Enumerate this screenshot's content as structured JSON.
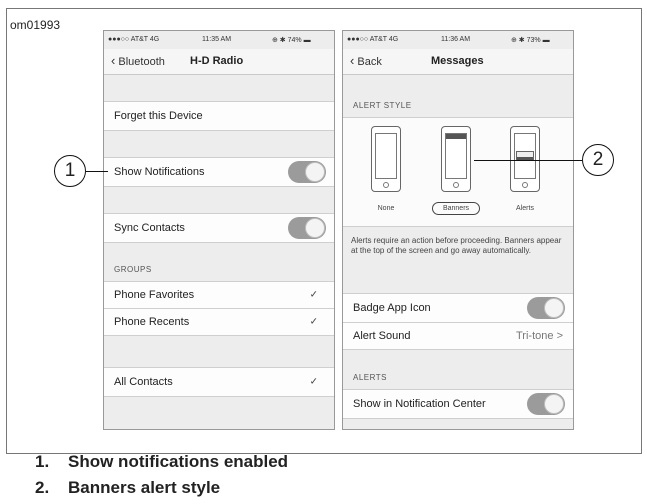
{
  "figure_id": "om01993",
  "phone1": {
    "status": {
      "carrier": "●●●○○ AT&T  4G",
      "time": "11:35 AM",
      "battery": "⊕ ✱ 74% ▬"
    },
    "nav": {
      "back": "Bluetooth",
      "title": "H-D Radio"
    },
    "forget": "Forget this Device",
    "show_notifications": {
      "label": "Show Notifications",
      "on": true
    },
    "sync_contacts": {
      "label": "Sync Contacts",
      "on": true
    },
    "groups_header": "GROUPS",
    "phone_favorites": "Phone Favorites",
    "phone_recents": "Phone Recents",
    "all_contacts": "All Contacts",
    "check": "✓"
  },
  "phone2": {
    "status": {
      "carrier": "●●●○○ AT&T  4G",
      "time": "11:36 AM",
      "battery": "⊕ ✱ 73% ▬"
    },
    "nav": {
      "back": "Back",
      "title": "Messages"
    },
    "alert_style_header": "ALERT STYLE",
    "styles": {
      "none": "None",
      "banners": "Banners",
      "alerts": "Alerts",
      "selected": "Banners"
    },
    "info": "Alerts require an action before proceeding. Banners appear at the top of the screen and go away automatically.",
    "badge_app_icon": {
      "label": "Badge App Icon",
      "on": true
    },
    "alert_sound": {
      "label": "Alert Sound",
      "value": "Tri-tone",
      "chevron": ">"
    },
    "alerts_header": "ALERTS",
    "show_in_nc": {
      "label": "Show in Notification Center",
      "on": true
    }
  },
  "callouts": {
    "one": "1",
    "two": "2"
  },
  "captions": [
    {
      "num": "1.",
      "text": "Show notifications enabled"
    },
    {
      "num": "2.",
      "text": "Banners alert style"
    }
  ]
}
